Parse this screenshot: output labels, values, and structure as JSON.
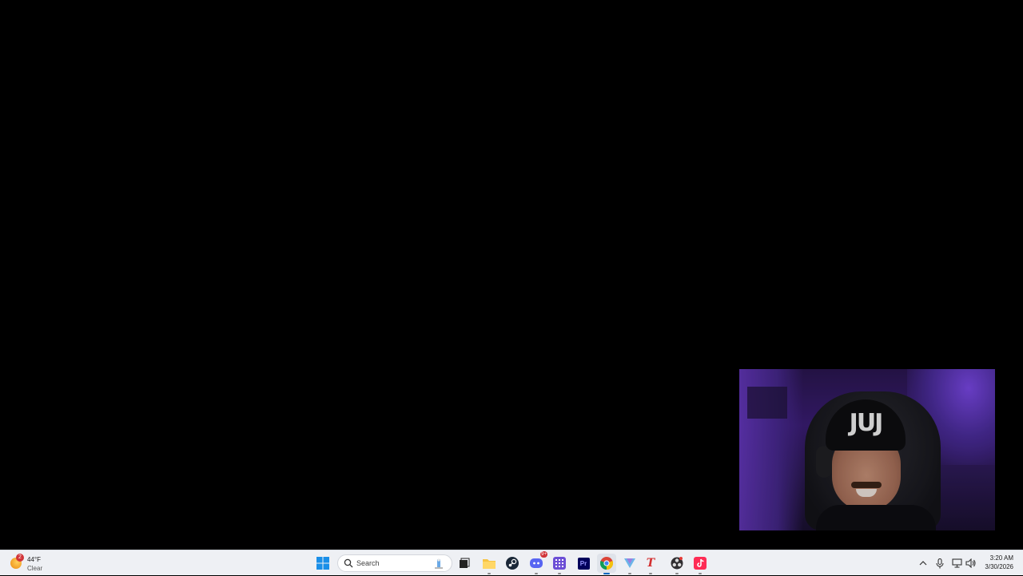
{
  "webcam": {
    "beanie_text": "JUJ"
  },
  "taskbar": {
    "weather": {
      "temp": "44°F",
      "condition": "Clear",
      "badge": "2"
    },
    "search": {
      "placeholder": "Search"
    },
    "apps": [
      {
        "name": "start-button",
        "icon": "windows-logo"
      },
      {
        "name": "task-view",
        "icon": "task-view-icon"
      },
      {
        "name": "file-explorer",
        "icon": "folder-icon"
      },
      {
        "name": "steam",
        "icon": "steam-icon"
      },
      {
        "name": "discord",
        "icon": "discord-icon",
        "badge": "9+"
      },
      {
        "name": "app-grid",
        "icon": "grid-app-icon"
      },
      {
        "name": "premiere-pro",
        "icon": "premiere-icon",
        "label": "Pr"
      },
      {
        "name": "chrome",
        "icon": "chrome-icon"
      },
      {
        "name": "app-v",
        "icon": "v-app-icon"
      },
      {
        "name": "app-t",
        "icon": "t-app-icon",
        "label": "T"
      },
      {
        "name": "app-obs",
        "icon": "obs-icon"
      },
      {
        "name": "tiktok",
        "icon": "tiktok-icon"
      }
    ],
    "clock": {
      "time": "3:20 AM",
      "date": "3/30/2026"
    }
  },
  "colors": {
    "taskbar_bg": "#eef0f4",
    "accent": "#0067c0",
    "tiktok": "#fe2c55",
    "premiere_bg": "#00005b",
    "premiere_fg": "#9999ff",
    "discord": "#5865f2"
  }
}
